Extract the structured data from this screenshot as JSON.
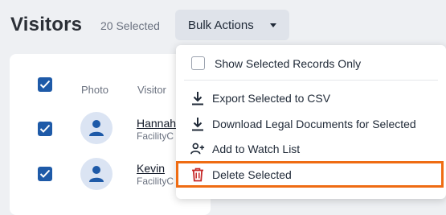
{
  "header": {
    "title": "Visitors",
    "selected_count": "20 Selected",
    "bulk_actions_label": "Bulk Actions"
  },
  "table": {
    "columns": [
      "Photo",
      "Visitor"
    ],
    "rows": [
      {
        "name": "Hannah",
        "subtitle": "FacilityC",
        "selected": true
      },
      {
        "name": "Kevin",
        "subtitle": "FacilityC",
        "selected": true
      }
    ]
  },
  "menu": {
    "show_selected_only": "Show Selected Records Only",
    "items": [
      {
        "label": "Export Selected to CSV",
        "icon": "download-icon"
      },
      {
        "label": "Download Legal Documents for Selected",
        "icon": "download-icon"
      },
      {
        "label": "Add to Watch List",
        "icon": "add-person-icon"
      },
      {
        "label": "Delete Selected",
        "icon": "trash-icon"
      }
    ]
  },
  "colors": {
    "accent_blue": "#1e5aa8",
    "delete_red": "#c62828",
    "highlight_orange": "#ef6c13"
  }
}
